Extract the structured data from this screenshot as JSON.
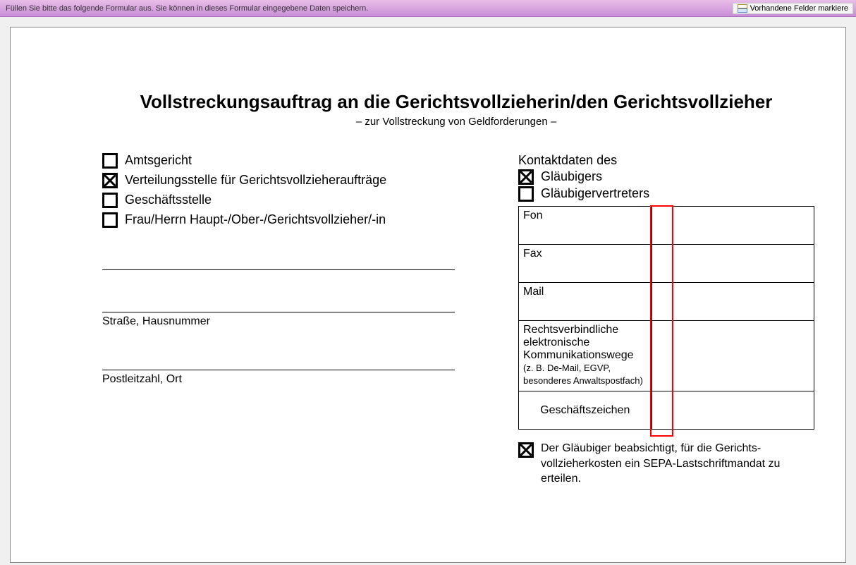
{
  "toolbar": {
    "instruction": "Füllen Sie bitte das folgende Formular aus. Sie können in dieses Formular eingegebene Daten speichern.",
    "highlight_button": "Vorhandene Felder markiere"
  },
  "form": {
    "title": "Vollstreckungsauftrag an die Gerichtsvollzieherin/den Gerichtsvollzieher",
    "subtitle": "– zur Vollstreckung von Geldforderungen –",
    "recipient": {
      "options": {
        "amtsgericht": {
          "label": "Amtsgericht",
          "checked": false
        },
        "verteilungsstelle": {
          "label": "Verteilungsstelle für Gerichtsvollzieheraufträge",
          "checked": true
        },
        "geschaeftsstelle": {
          "label": "Geschäftsstelle",
          "checked": false
        },
        "frau_herrn_gv": {
          "label": "Frau/Herrn Haupt-/Ober-/Gerichtsvollzieher/-in",
          "checked": false
        }
      },
      "line_name_value": "",
      "line_street_value": "",
      "line_street_caption": "Straße, Hausnummer",
      "line_city_value": "",
      "line_city_caption": "Postleitzahl, Ort"
    },
    "contact": {
      "heading": "Kontaktdaten des",
      "of_creditor": {
        "label": "Gläubigers",
        "checked": true
      },
      "of_representative": {
        "label": "Gläubigervertreters",
        "checked": false
      },
      "rows": {
        "fon": {
          "label": "Fon",
          "value": ""
        },
        "fax": {
          "label": "Fax",
          "value": ""
        },
        "mail": {
          "label": "Mail",
          "value": ""
        },
        "ecom": {
          "label": "Rechtsverbindliche elektronische Kommunikationswege",
          "sub": "(z. B. De-Mail, EGVP, besonderes Anwaltspostfach)",
          "value": ""
        },
        "gz": {
          "label": "Geschäftszeichen",
          "value": ""
        }
      }
    },
    "sepa": {
      "checked": true,
      "text": "Der Gläubiger beabsichtigt, für die Gerichts­vollzieherkosten ein SEPA-Lastschriftmandat zu erteilen."
    }
  }
}
